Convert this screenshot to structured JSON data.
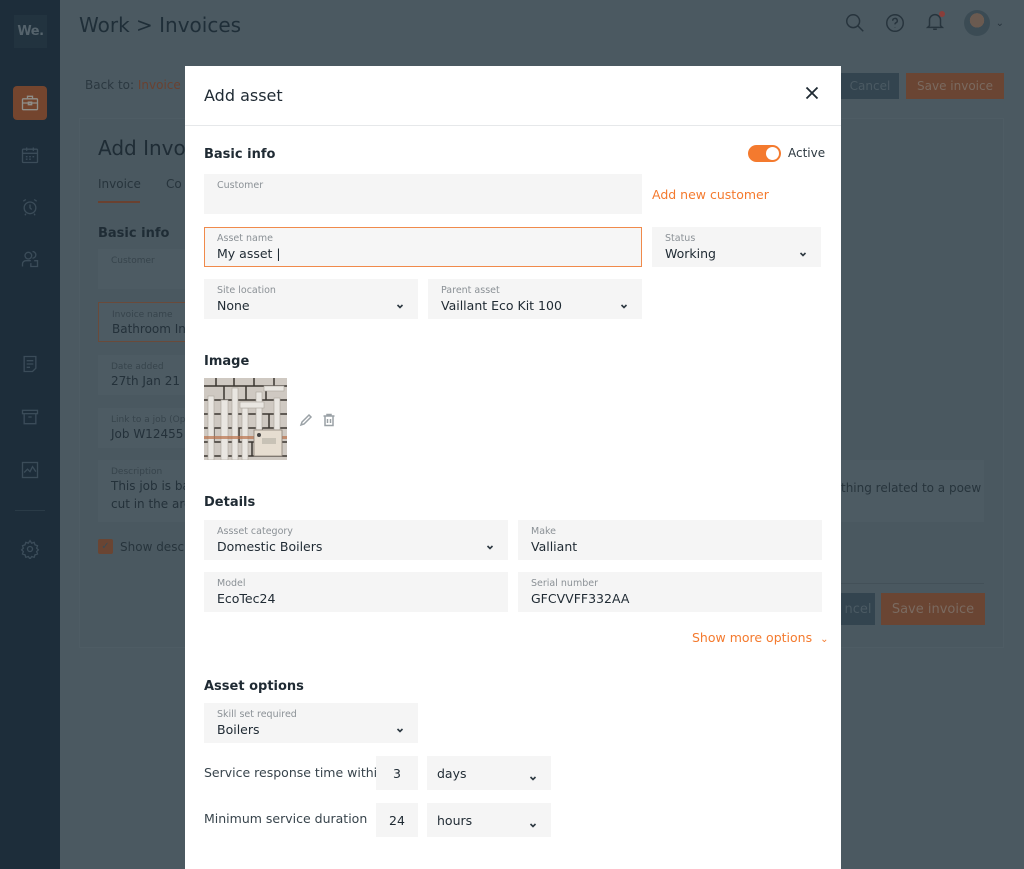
{
  "app": {
    "logo": "We.",
    "breadcrumb": "Work > Invoices",
    "sidebar": {
      "items": [
        {
          "icon": "briefcase-icon",
          "active": true
        },
        {
          "icon": "calendar-icon",
          "active": false
        },
        {
          "icon": "alarm-clock-icon",
          "active": false
        },
        {
          "icon": "users-icon",
          "active": false
        },
        {
          "icon": "document-icon",
          "active": false
        },
        {
          "icon": "archive-icon",
          "active": false
        },
        {
          "icon": "chart-icon",
          "active": false
        },
        {
          "icon": "gear-icon",
          "active": false
        }
      ]
    },
    "top_icons": [
      "search-icon",
      "help-icon",
      "bell-icon",
      "avatar"
    ],
    "accent_color": "#f47a2e"
  },
  "background_page": {
    "back_to_label": "Back to:",
    "back_to_link": "Invoice l",
    "cancel_label": "Cancel",
    "save_label": "Save invoice",
    "title": "Add Invoi",
    "tabs": [
      "Invoice",
      "Co"
    ],
    "section_title": "Basic info",
    "fields": [
      {
        "label": "Customer",
        "value": ""
      },
      {
        "label": "Invoice name",
        "value": "Bathroom Ins"
      },
      {
        "label": "Date added",
        "value": "27th Jan 21"
      },
      {
        "label": "Link to a job (Op",
        "value": "Job W12455"
      },
      {
        "label": "Description",
        "value": "This job is ba",
        "value2": "cut in the are"
      }
    ],
    "description_tail": "thing related to a poew",
    "show_description_label": "Show descri",
    "bottom_cancel_label": "ncel",
    "bottom_save_label": "Save invoice"
  },
  "modal": {
    "title": "Add asset",
    "basic_info": {
      "title": "Basic info",
      "active_toggle": {
        "label": "Active",
        "on": true
      },
      "customer": {
        "label": "Customer",
        "value": ""
      },
      "add_customer_link": "Add new customer",
      "asset_name": {
        "label": "Asset name",
        "value": "My asset |"
      },
      "status": {
        "label": "Status",
        "value": "Working"
      },
      "site_location": {
        "label": "Site location",
        "value": "None"
      },
      "parent_asset": {
        "label": "Parent asset",
        "value": "Vaillant Eco Kit 100"
      }
    },
    "image": {
      "title": "Image"
    },
    "details": {
      "title": "Details",
      "asset_category": {
        "label": "Assset category",
        "value": "Domestic Boilers"
      },
      "make": {
        "label": "Make",
        "value": "Valliant"
      },
      "model": {
        "label": "Model",
        "value": "EcoTec24"
      },
      "serial_number": {
        "label": "Serial number",
        "value": "GFCVVFF332AA"
      },
      "show_more_link": "Show more options"
    },
    "asset_options": {
      "title": "Asset options",
      "skill_set": {
        "label": "Skill set required",
        "value": "Boilers"
      },
      "response_time": {
        "label": "Service response time within",
        "value": "3",
        "unit": "days"
      },
      "min_duration": {
        "label": "Minimum service duration",
        "value": "24",
        "unit": "hours"
      }
    }
  }
}
